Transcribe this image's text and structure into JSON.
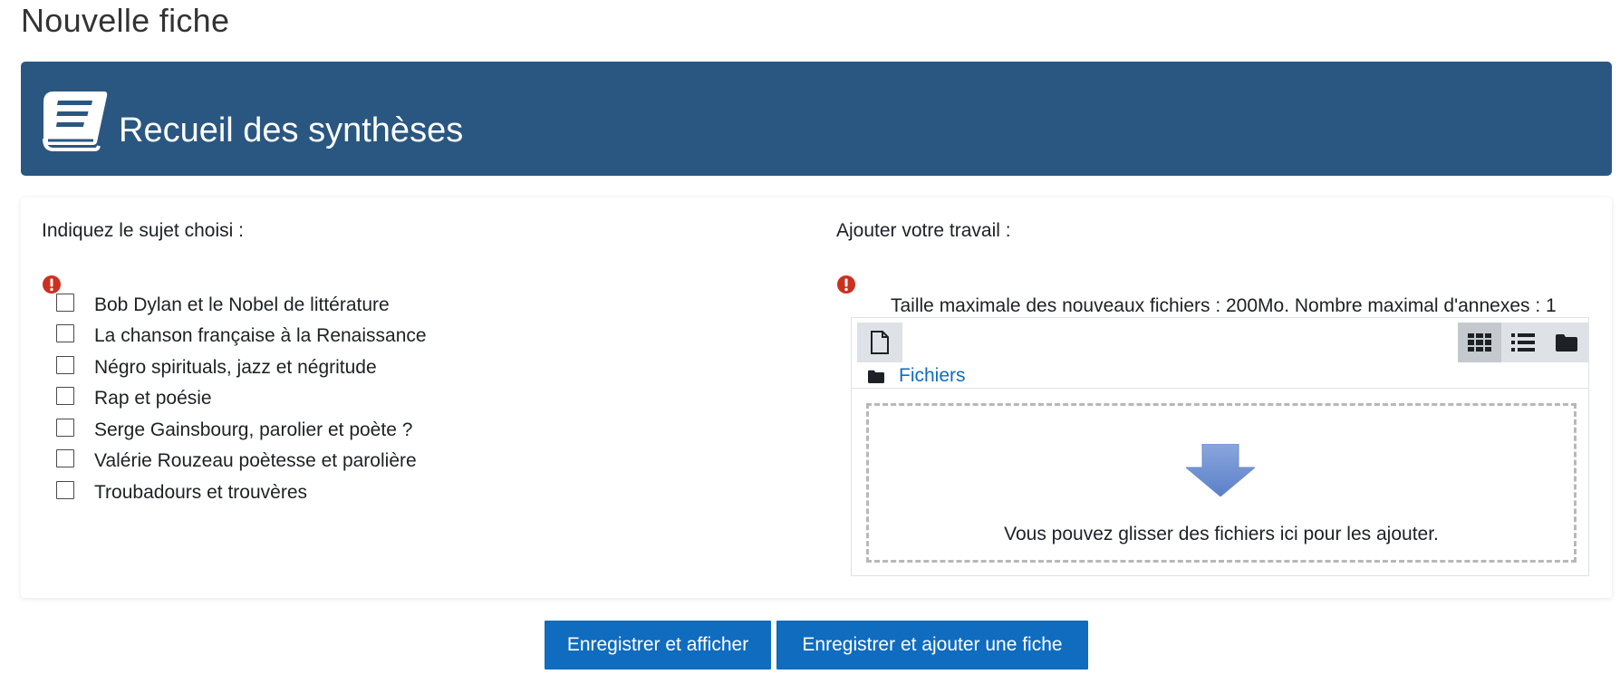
{
  "page": {
    "title": "Nouvelle fiche"
  },
  "banner": {
    "title": "Recueil des synthèses",
    "icon": "book-icon",
    "color": "#2a5781"
  },
  "form": {
    "subject_label": "Indiquez le sujet choisi :",
    "subjects": [
      {
        "label": "Bob Dylan et le Nobel de littérature",
        "checked": false
      },
      {
        "label": "La chanson française à la Renaissance",
        "checked": false
      },
      {
        "label": "Négro spirituals, jazz et négritude",
        "checked": false
      },
      {
        "label": "Rap et poésie",
        "checked": false
      },
      {
        "label": "Serge Gainsbourg, parolier et poète ?",
        "checked": false
      },
      {
        "label": "Valérie Rouzeau poètesse et parolière",
        "checked": false
      },
      {
        "label": "Troubadours et trouvères",
        "checked": false
      }
    ],
    "work_label": "Ajouter votre travail :",
    "required_icon": "exclamation-circle-icon",
    "required_color": "#ca3120"
  },
  "filemanager": {
    "info": "Taille maximale des nouveaux fichiers : 200Mo. Nombre maximal d'annexes : 1",
    "add_icon": "add-file-icon",
    "views": [
      "grid-view-icon",
      "list-view-icon",
      "tree-view-icon"
    ],
    "active_view": "grid-view-icon",
    "path_icon": "folder-icon",
    "path_label": "Fichiers",
    "dropzone_text": "Vous pouvez glisser des fichiers ici pour les ajouter.",
    "dropzone_icon": "down-arrow-icon"
  },
  "buttons": {
    "save_display": "Enregistrer et afficher",
    "save_add": "Enregistrer et ajouter une fiche",
    "color": "#0f6cbf"
  }
}
